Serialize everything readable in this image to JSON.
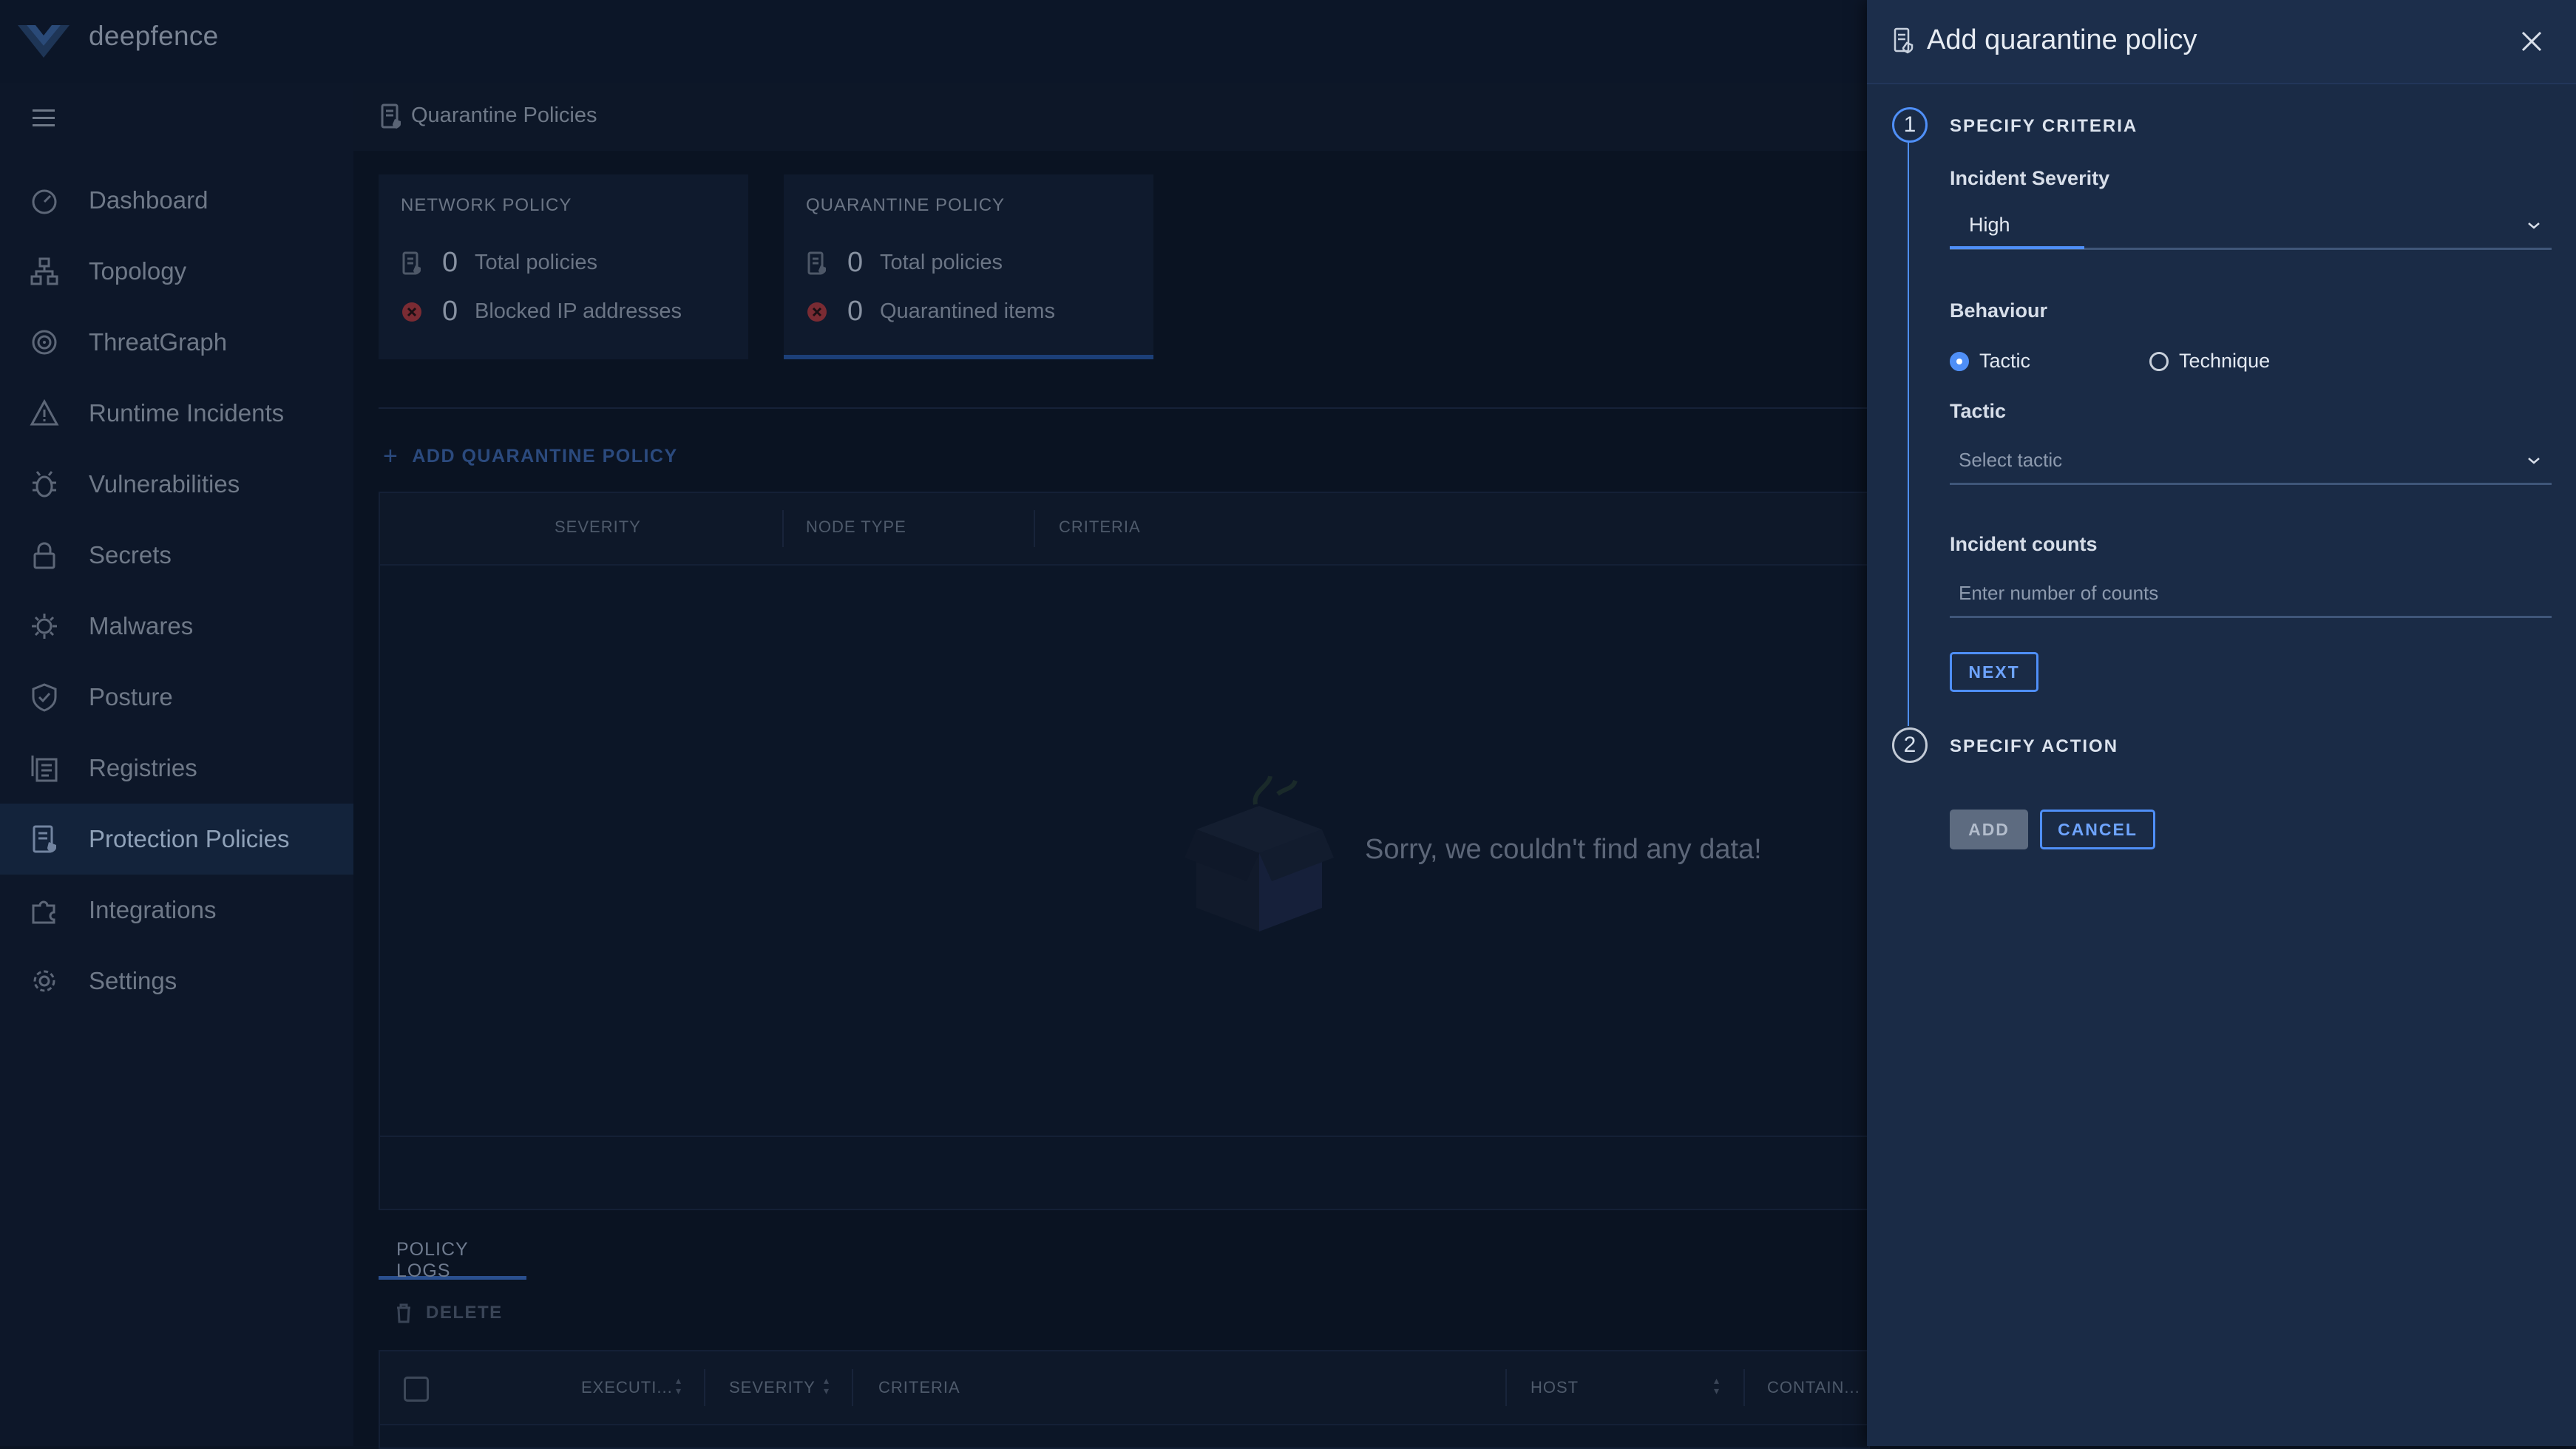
{
  "app": {
    "brand": "deepfence"
  },
  "sidebar": {
    "items": [
      {
        "label": "Dashboard",
        "icon": "dashboard-icon"
      },
      {
        "label": "Topology",
        "icon": "topology-icon"
      },
      {
        "label": "ThreatGraph",
        "icon": "threatgraph-icon"
      },
      {
        "label": "Runtime Incidents",
        "icon": "warning-triangle-icon"
      },
      {
        "label": "Vulnerabilities",
        "icon": "bug-icon"
      },
      {
        "label": "Secrets",
        "icon": "lock-icon"
      },
      {
        "label": "Malwares",
        "icon": "malware-icon"
      },
      {
        "label": "Posture",
        "icon": "shield-icon"
      },
      {
        "label": "Registries",
        "icon": "registry-icon"
      },
      {
        "label": "Protection Policies",
        "icon": "policy-icon",
        "active": true
      },
      {
        "label": "Integrations",
        "icon": "puzzle-icon"
      },
      {
        "label": "Settings",
        "icon": "gear-icon"
      }
    ]
  },
  "main": {
    "breadcrumb": "Quarantine Policies",
    "network_card": {
      "title": "NETWORK POLICY",
      "rows": [
        {
          "value": "0",
          "label": "Total policies"
        },
        {
          "value": "0",
          "label": "Blocked IP addresses"
        }
      ]
    },
    "quarantine_card": {
      "title": "QUARANTINE POLICY",
      "rows": [
        {
          "value": "0",
          "label": "Total policies"
        },
        {
          "value": "0",
          "label": "Quarantined items"
        }
      ]
    },
    "add_button": "ADD QUARANTINE POLICY",
    "table_headers": [
      "SEVERITY",
      "NODE TYPE",
      "CRITERIA"
    ],
    "empty_message": "Sorry, we couldn't find any data!",
    "logs_tab": "POLICY LOGS",
    "delete_label": "DELETE",
    "logs_headers": [
      "EXECUTI...",
      "SEVERITY",
      "CRITERIA",
      "HOST",
      "CONTAIN..."
    ]
  },
  "drawer": {
    "title": "Add quarantine policy",
    "step1": {
      "number": "1",
      "title": "SPECIFY CRITERIA",
      "severity_label": "Incident Severity",
      "severity_value": "High",
      "behaviour_label": "Behaviour",
      "radio_tactic": "Tactic",
      "radio_technique": "Technique",
      "selected_behaviour": "Tactic",
      "tactic_label": "Tactic",
      "tactic_placeholder": "Select tactic",
      "counts_label": "Incident counts",
      "counts_placeholder": "Enter number of counts",
      "next_label": "NEXT"
    },
    "step2": {
      "number": "2",
      "title": "SPECIFY ACTION"
    },
    "add_label": "ADD",
    "cancel_label": "CANCEL"
  },
  "colors": {
    "accent": "#4f8ff7",
    "danger": "#7a2b33",
    "drawer_bg": "#1a2b46",
    "page_bg": "#0b1423"
  }
}
